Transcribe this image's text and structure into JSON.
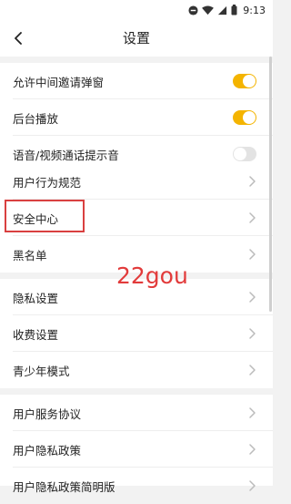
{
  "status_bar": {
    "time": "9:13"
  },
  "header": {
    "title": "设置"
  },
  "groups": [
    {
      "items": [
        {
          "label": "允许中间邀请弹窗",
          "control": "toggle",
          "on": true
        },
        {
          "label": "后台播放",
          "control": "toggle",
          "on": true
        },
        {
          "label": "语音/视频通话提示音",
          "control": "toggle",
          "on": false
        }
      ]
    },
    {
      "items": [
        {
          "label": "用户行为规范",
          "control": "chevron"
        },
        {
          "label": "安全中心",
          "control": "chevron",
          "highlighted": true
        },
        {
          "label": "黑名单",
          "control": "chevron"
        }
      ]
    },
    {
      "items": [
        {
          "label": "隐私设置",
          "control": "chevron"
        },
        {
          "label": "收费设置",
          "control": "chevron"
        },
        {
          "label": "青少年模式",
          "control": "chevron"
        }
      ]
    },
    {
      "items": [
        {
          "label": "用户服务协议",
          "control": "chevron"
        },
        {
          "label": "用户隐私政策",
          "control": "chevron"
        },
        {
          "label": "用户隐私政策简明版",
          "control": "chevron"
        }
      ]
    }
  ],
  "watermark": {
    "text": "22gou"
  },
  "colors": {
    "toggle_on": "#f4b400",
    "toggle_off": "#e3e3e3",
    "highlight": "#d94040",
    "watermark": "#e23b3b"
  }
}
